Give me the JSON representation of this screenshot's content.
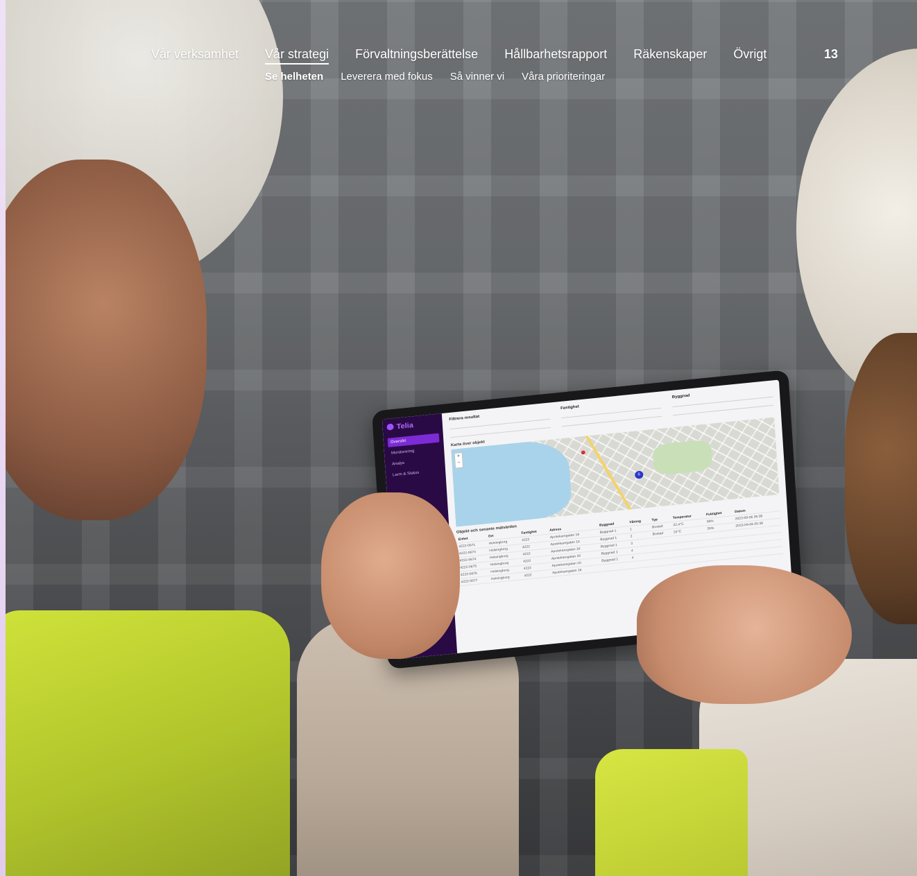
{
  "nav": {
    "items": [
      {
        "label": "Vår verksamhet"
      },
      {
        "label": "Vår strategi"
      },
      {
        "label": "Förvaltningsberättelse"
      },
      {
        "label": "Hållbarhetsrapport"
      },
      {
        "label": "Räkenskaper"
      },
      {
        "label": "Övrigt"
      }
    ],
    "page_number": "13",
    "sub_items": [
      {
        "label": "Se helheten"
      },
      {
        "label": "Leverera med fokus"
      },
      {
        "label": "Så vinner vi"
      },
      {
        "label": "Våra prioriteringar"
      }
    ]
  },
  "tablet": {
    "brand": "Telia",
    "sidebar": [
      {
        "label": "Översikt"
      },
      {
        "label": "Monitorering"
      },
      {
        "label": "Analys"
      },
      {
        "label": "Larm & Status"
      }
    ],
    "filters": [
      {
        "label": "Filtrera resultat"
      },
      {
        "label": "Fastighet"
      },
      {
        "label": "Byggnad"
      }
    ],
    "map_title": "Karta över objekt",
    "map_pin": "6",
    "table_title": "Objekt och senaste mätvärden",
    "columns": [
      "Enhet",
      "Ort",
      "Fastighet",
      "Adress",
      "Byggnad",
      "Våning",
      "Typ",
      "Temperatur",
      "Fuktighet",
      "Datum"
    ],
    "rows": [
      [
        "4222-0671",
        "Helsingborg",
        "4222",
        "Apotekaregatan 16",
        "Byggnad 1",
        "1",
        "Bostad",
        "22,4°C",
        "38%",
        "2023-09-06 05:38"
      ],
      [
        "4222-0673",
        "Helsingborg",
        "4222",
        "Apotekaregatan 16",
        "Byggnad 1",
        "2",
        "Bostad",
        "24°C",
        "35%",
        "2023-09-06 05:38"
      ],
      [
        "4222-0674",
        "Helsingborg",
        "4222",
        "Apotekaregatan 16",
        "Byggnad 1",
        "3",
        "",
        "",
        "",
        ""
      ],
      [
        "4222-0675",
        "Helsingborg",
        "4222",
        "Apotekaregatan 16",
        "Byggnad 1",
        "4",
        "",
        "",
        "",
        ""
      ],
      [
        "4222-0676",
        "Helsingborg",
        "4222",
        "Apotekaregatan 16",
        "Byggnad 1",
        "4",
        "",
        "",
        "",
        ""
      ],
      [
        "4222-0677",
        "Helsingborg",
        "4222",
        "Apotekaregatan 16",
        "",
        "",
        "",
        "",
        "",
        ""
      ]
    ]
  }
}
